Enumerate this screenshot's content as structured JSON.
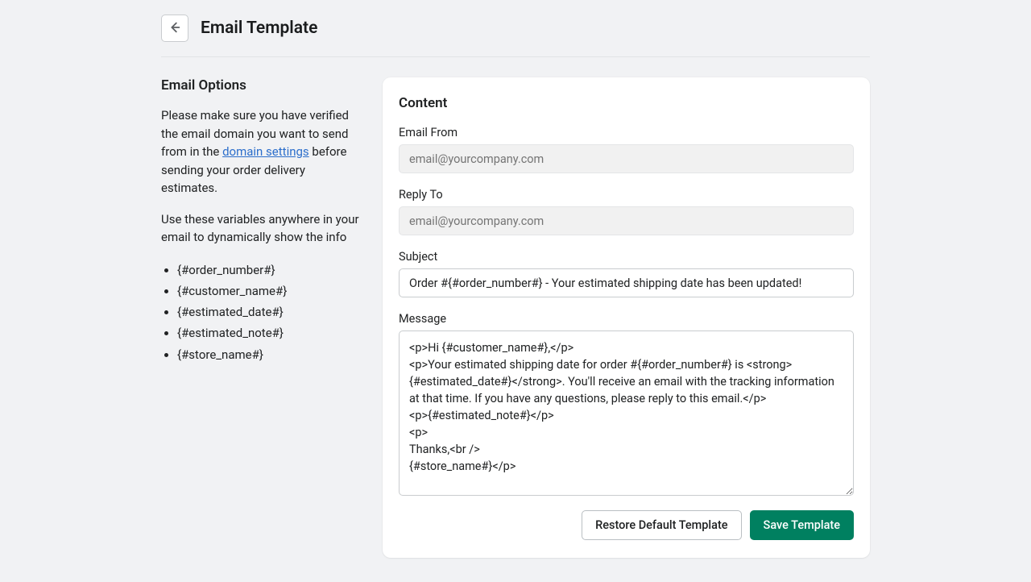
{
  "header": {
    "title": "Email Template"
  },
  "sidebar": {
    "heading": "Email Options",
    "intro_part1": "Please make sure you have verified the email domain you want to send from in the ",
    "intro_link": "domain settings",
    "intro_part2": " before sending your order delivery estimates.",
    "variables_intro": "Use these variables anywhere in your email to dynamically show the info",
    "variables": [
      "{#order_number#}",
      "{#customer_name#}",
      "{#estimated_date#}",
      "{#estimated_note#}",
      "{#store_name#}"
    ]
  },
  "card": {
    "title": "Content",
    "email_from": {
      "label": "Email From",
      "placeholder": "email@yourcompany.com",
      "value": ""
    },
    "reply_to": {
      "label": "Reply To",
      "placeholder": "email@yourcompany.com",
      "value": ""
    },
    "subject": {
      "label": "Subject",
      "value": "Order #{#order_number#} - Your estimated shipping date has been updated!"
    },
    "message": {
      "label": "Message",
      "value": "<p>Hi {#customer_name#},</p>\n<p>Your estimated shipping date for order #{#order_number#} is <strong>{#estimated_date#}</strong>. You'll receive an email with the tracking information at that time. If you have any questions, please reply to this email.</p>\n<p>{#estimated_note#}</p>\n<p>\nThanks,<br />\n{#store_name#}</p>"
    },
    "buttons": {
      "restore": "Restore Default Template",
      "save": "Save Template"
    }
  }
}
